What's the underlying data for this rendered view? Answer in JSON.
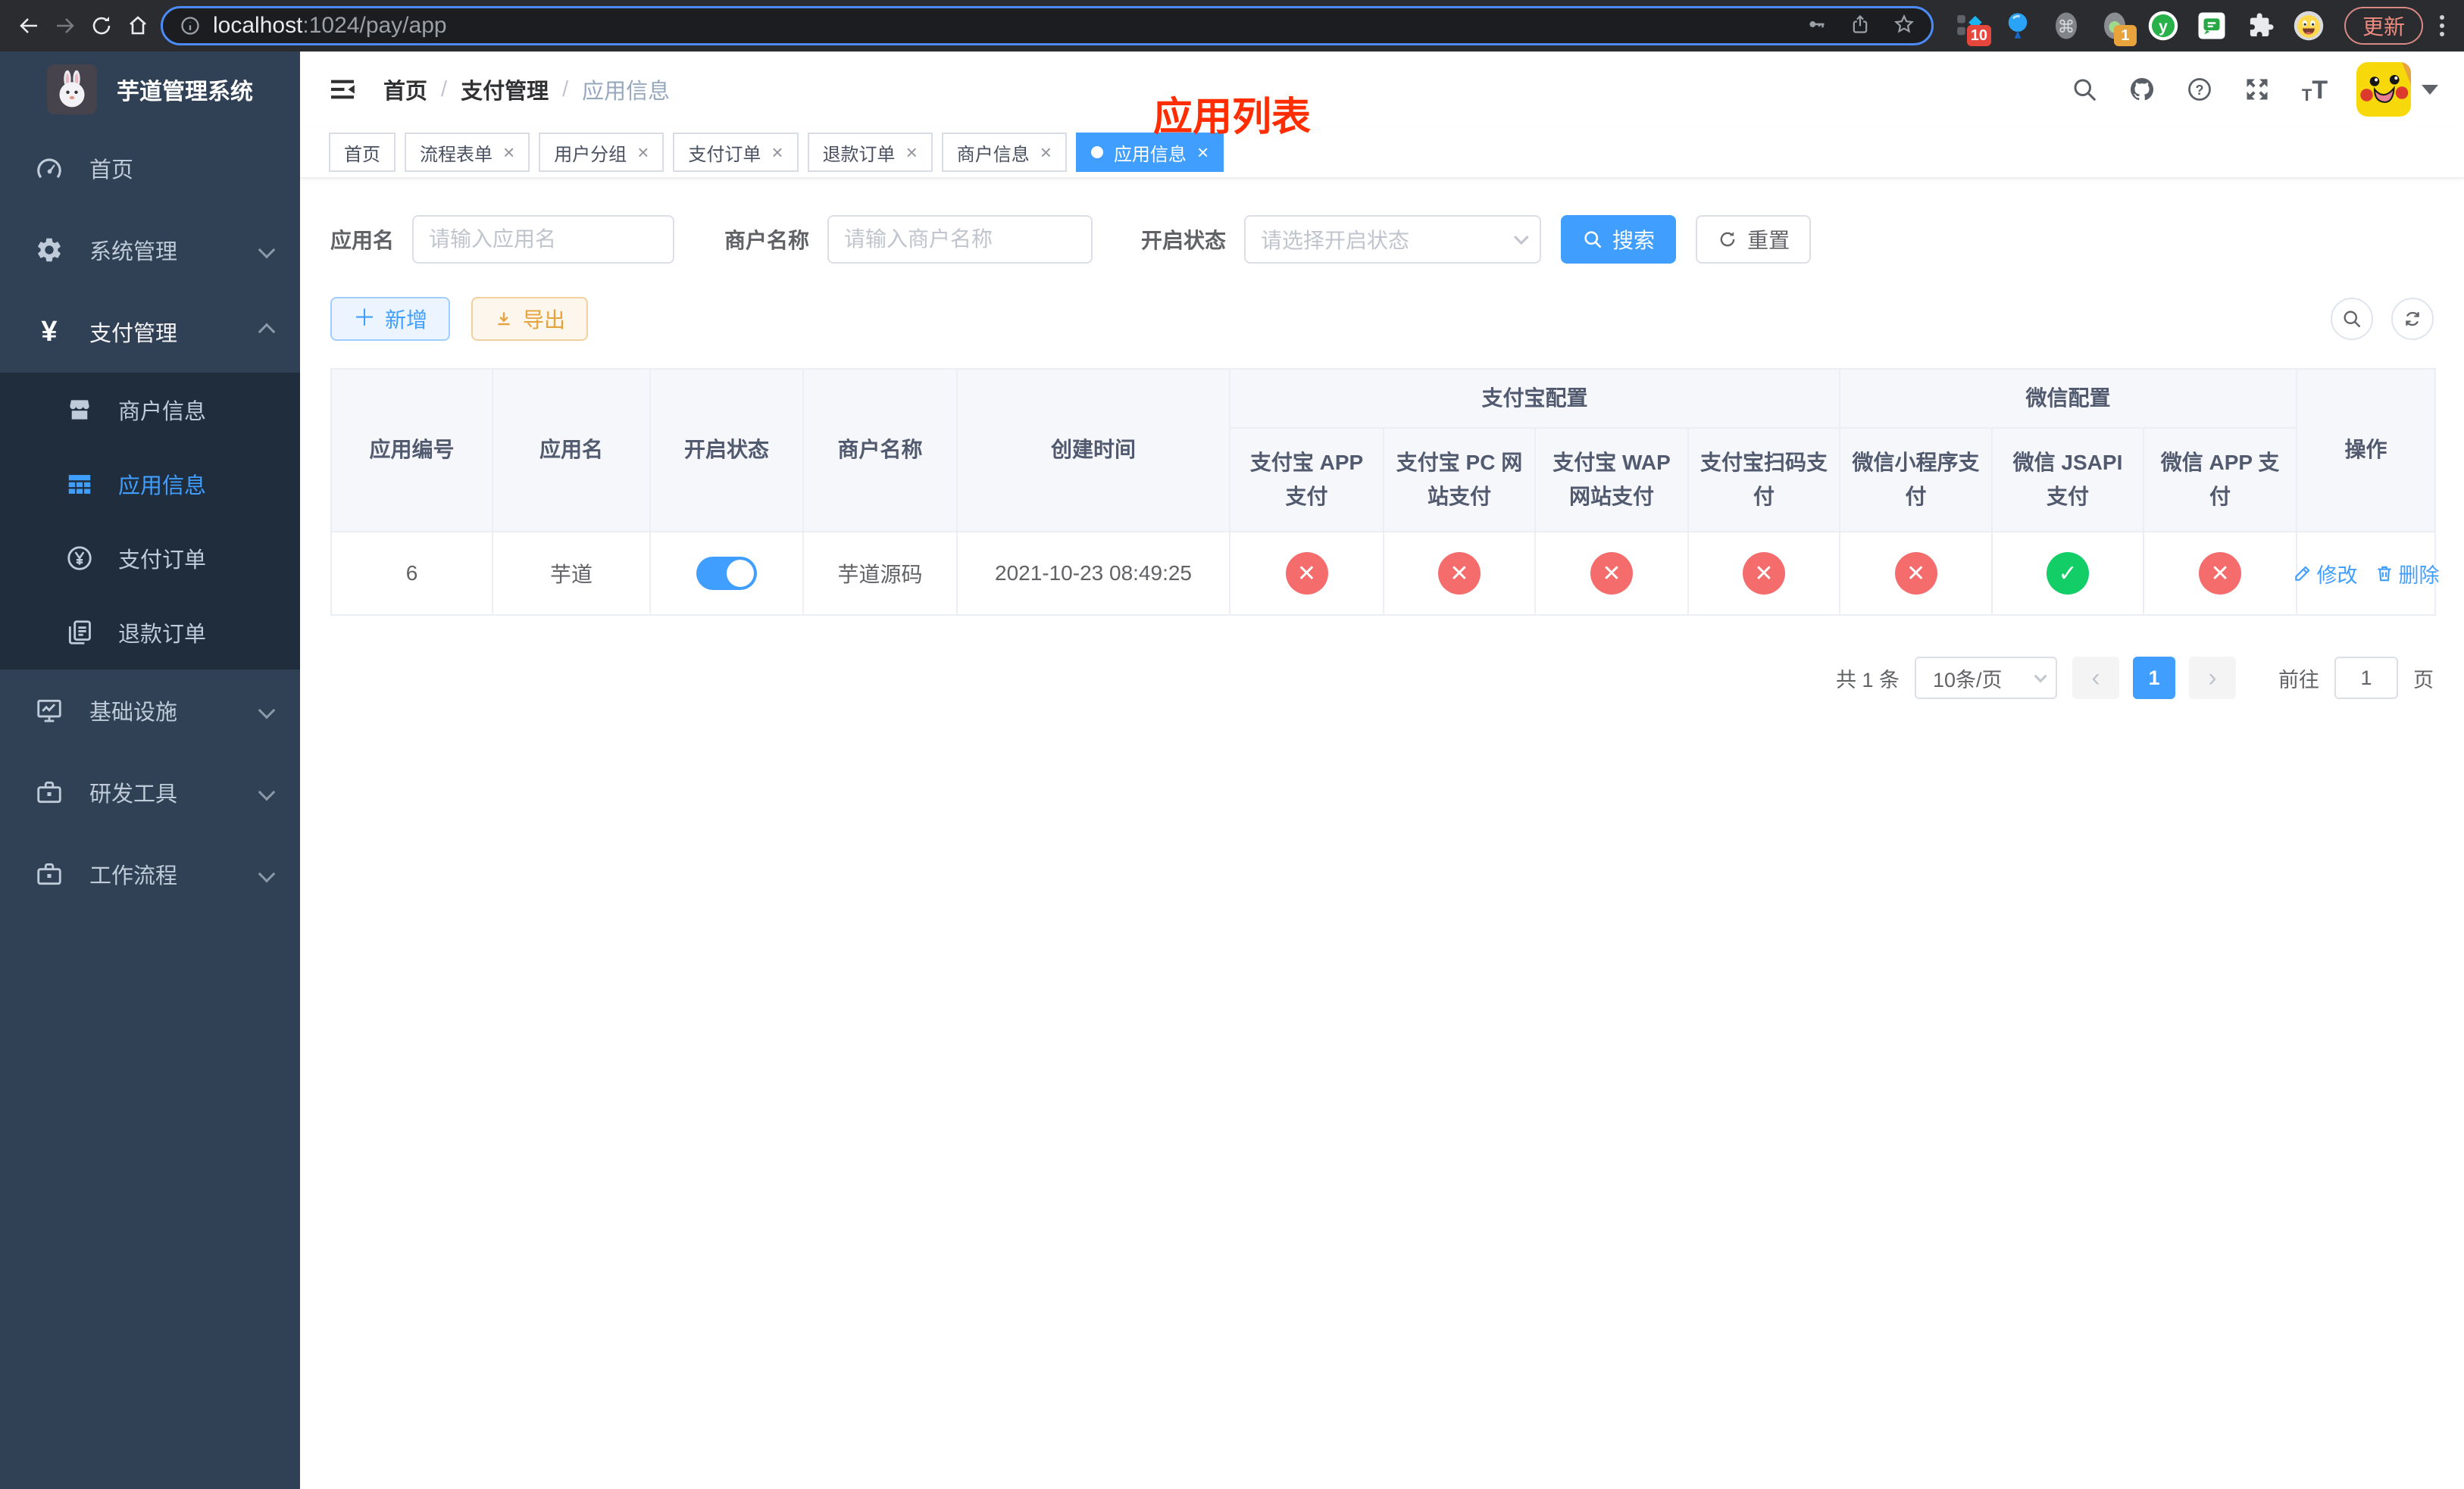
{
  "browser": {
    "url_host": "localhost",
    "url_rest": ":1024/pay/app",
    "update_label": "更新",
    "ext_badge_blue_diamond": "10",
    "ext_badge_camera": "1"
  },
  "sidebar": {
    "logo_title": "芋道管理系统",
    "menu": [
      {
        "label": "首页"
      },
      {
        "label": "系统管理"
      },
      {
        "label": "支付管理"
      },
      {
        "label": "商户信息"
      },
      {
        "label": "应用信息"
      },
      {
        "label": "支付订单"
      },
      {
        "label": "退款订单"
      },
      {
        "label": "基础设施"
      },
      {
        "label": "研发工具"
      },
      {
        "label": "工作流程"
      }
    ]
  },
  "navbar": {
    "breadcrumb": [
      "首页",
      "支付管理",
      "应用信息"
    ],
    "overlay_title": "应用列表"
  },
  "tags": [
    {
      "label": "首页"
    },
    {
      "label": "流程表单"
    },
    {
      "label": "用户分组"
    },
    {
      "label": "支付订单"
    },
    {
      "label": "退款订单"
    },
    {
      "label": "商户信息"
    },
    {
      "label": "应用信息"
    }
  ],
  "filters": {
    "app_name_label": "应用名",
    "app_name_placeholder": "请输入应用名",
    "merchant_label": "商户名称",
    "merchant_placeholder": "请输入商户名称",
    "status_label": "开启状态",
    "status_placeholder": "请选择开启状态",
    "search_label": "搜索",
    "reset_label": "重置"
  },
  "toolbar": {
    "add_label": "新增",
    "export_label": "导出"
  },
  "table": {
    "headers": {
      "app_id": "应用编号",
      "app_name": "应用名",
      "open_status": "开启状态",
      "merchant_name": "商户名称",
      "create_time": "创建时间",
      "alipay_group": "支付宝配置",
      "wechat_group": "微信配置",
      "actions": "操作",
      "alipay_cols": [
        "支付宝 APP 支付",
        "支付宝 PC 网站支付",
        "支付宝 WAP 网站支付",
        "支付宝扫码支付"
      ],
      "wechat_cols": [
        "微信小程序支付",
        "微信 JSAPI 支付",
        "微信 APP 支付"
      ]
    },
    "row": {
      "app_id": "6",
      "app_name": "芋道",
      "open_status": "on",
      "merchant_name": "芋道源码",
      "create_time": "2021-10-23 08:49:25",
      "statuses": [
        "fail",
        "fail",
        "fail",
        "fail",
        "fail",
        "success",
        "fail"
      ],
      "edit_label": "修改",
      "delete_label": "删除"
    }
  },
  "pagination": {
    "total_label": "共 1 条",
    "page_size": "10条/页",
    "current_page": "1",
    "goto_label": "前往",
    "goto_value": "1",
    "page_unit": "页"
  },
  "colors": {
    "primary": "#409eff",
    "success": "#13ce66",
    "danger": "#f56c6c",
    "warning": "#e6a23c",
    "overlay_title": "#ff2d00",
    "sidebar_bg": "#304156",
    "submenu_bg": "#1f2d3d"
  }
}
